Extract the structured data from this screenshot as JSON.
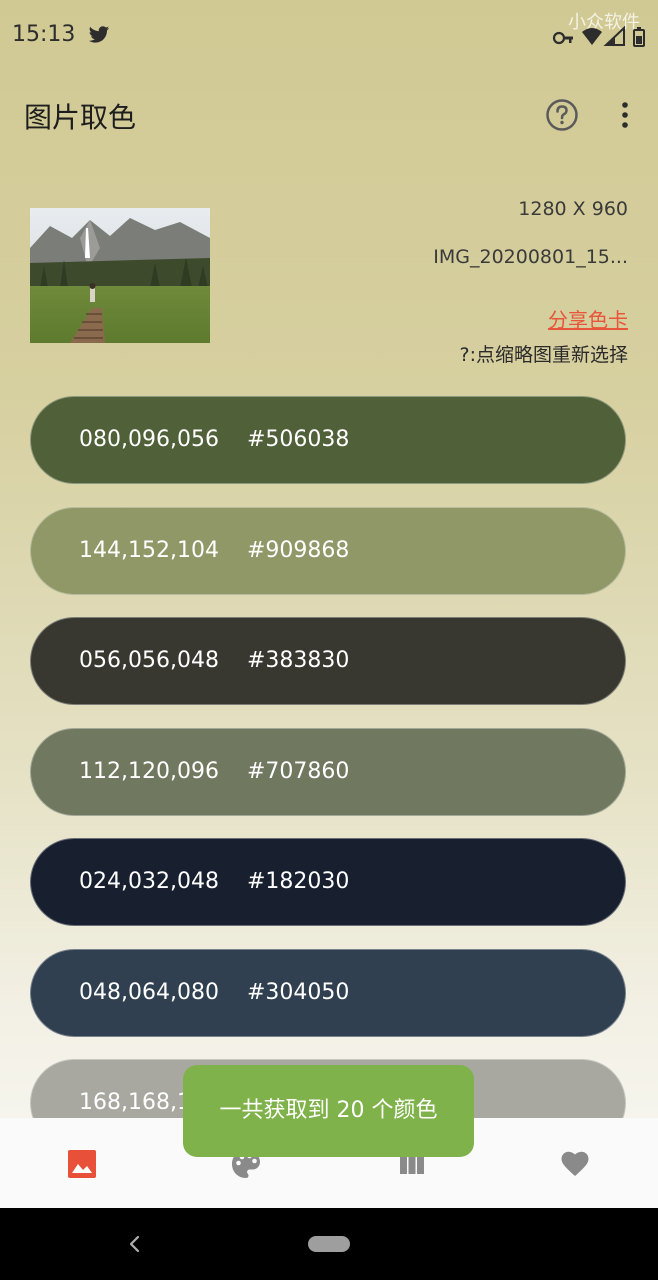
{
  "status_bar": {
    "time": "15:13",
    "watermark": "小众软件",
    "icons": [
      "twitter-icon",
      "vpn-key-icon",
      "wifi-icon",
      "signal-icon",
      "battery-icon"
    ]
  },
  "app_bar": {
    "title": "图片取色",
    "icons": [
      "help-icon",
      "more-vert-icon"
    ]
  },
  "image_info": {
    "resolution": "1280 X 960",
    "filename": "IMG_20200801_15...",
    "share_label": "分享色卡",
    "hint": "?:点缩略图重新选择"
  },
  "swatches": [
    {
      "rgb": "080,096,056",
      "hex": "#506038",
      "color": "#506038"
    },
    {
      "rgb": "144,152,104",
      "hex": "#909868",
      "color": "#909868"
    },
    {
      "rgb": "056,056,048",
      "hex": "#383830",
      "color": "#383830"
    },
    {
      "rgb": "112,120,096",
      "hex": "#707860",
      "color": "#707860"
    },
    {
      "rgb": "024,032,048",
      "hex": "#182030",
      "color": "#182030"
    },
    {
      "rgb": "048,064,080",
      "hex": "#304050",
      "color": "#304050"
    },
    {
      "rgb": "168,168,1",
      "hex": "",
      "color": "#a8a8a0"
    }
  ],
  "toast": {
    "text": "一共获取到 20 个颜色",
    "color": "#7fb24a"
  },
  "bottom_nav": {
    "items": [
      "gallery-icon",
      "palette-icon",
      "columns-icon",
      "favorite-icon"
    ],
    "active_color": "#e9503a",
    "inactive_color": "#8a8a8a"
  },
  "system_nav": {
    "icons": [
      "back-icon",
      "home-pill"
    ]
  }
}
